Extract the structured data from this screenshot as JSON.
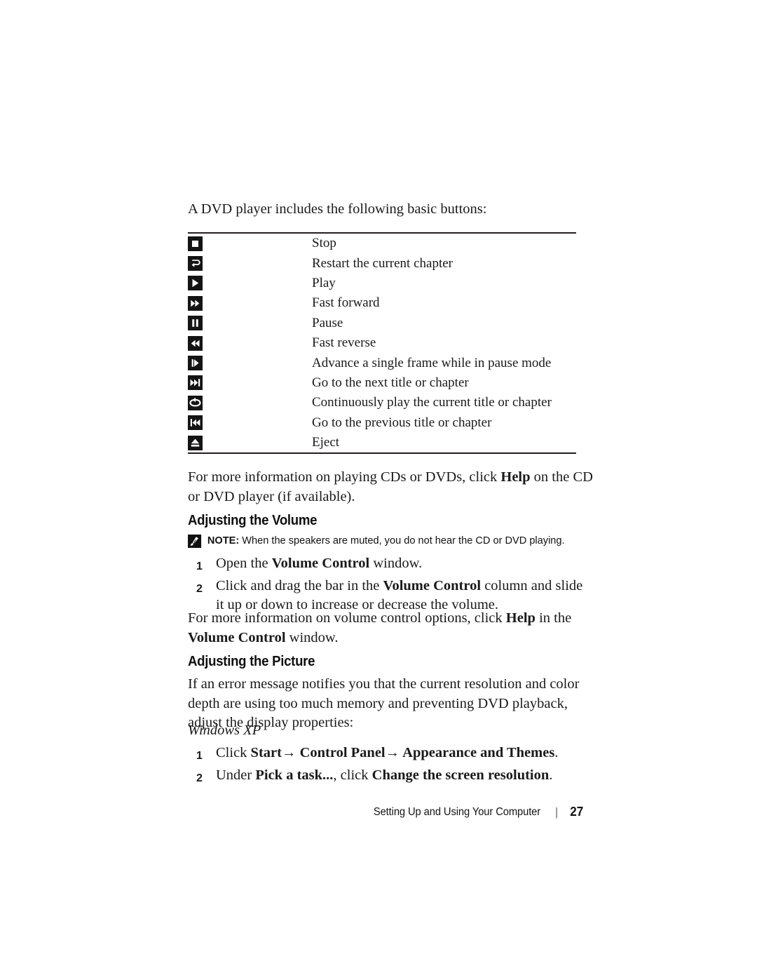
{
  "page": {
    "intro_text": "A DVD player includes the following basic buttons:",
    "windows_label": "Windows XP"
  },
  "button_table": {
    "rows": [
      {
        "icon": "stop-icon",
        "description": "Stop"
      },
      {
        "icon": "restart-chapter-icon",
        "description": "Restart the current chapter"
      },
      {
        "icon": "play-icon",
        "description": "Play"
      },
      {
        "icon": "fast-forward-icon",
        "description": "Fast forward"
      },
      {
        "icon": "pause-icon",
        "description": "Pause"
      },
      {
        "icon": "fast-reverse-icon",
        "description": "Fast reverse"
      },
      {
        "icon": "frame-advance-icon",
        "description": "Advance a single frame while in pause mode"
      },
      {
        "icon": "next-title-icon",
        "description": "Go to the next title or chapter"
      },
      {
        "icon": "loop-play-icon",
        "description": "Continuously play the current title or chapter"
      },
      {
        "icon": "previous-title-icon",
        "description": "Go to the previous title or chapter"
      },
      {
        "icon": "eject-icon",
        "description": "Eject"
      }
    ]
  },
  "sections": {
    "more_info_cd": {
      "part1": "For more information on playing CDs or DVDs, click ",
      "bold1": "Help",
      "part2": " on the CD or DVD player (if available)."
    },
    "volume": {
      "heading": "Adjusting the Volume",
      "note_label": "NOTE:",
      "note_text": " When the speakers are muted, you do not hear the CD or DVD playing.",
      "steps": [
        {
          "number": "1",
          "part1": "Open the ",
          "bold1": "Volume Control",
          "part2": " window."
        },
        {
          "number": "2",
          "part1": "Click and drag the bar in the ",
          "bold1": "Volume Control",
          "part2": " column and slide it up or down to increase or decrease the volume."
        }
      ],
      "more_info": {
        "part1": "For more information on volume control options, click ",
        "bold1": "Help",
        "part2": " in the ",
        "bold2": "Volume Control",
        "part3": " window."
      }
    },
    "picture": {
      "heading": "Adjusting the Picture",
      "body": "If an error message notifies you that the current resolution and color depth are using too much memory and preventing DVD playback, adjust the display properties:",
      "steps": [
        {
          "number": "1",
          "part1": "Click ",
          "bold1": "Start",
          "arrow1": "→",
          "bold2": " Control Panel",
          "arrow2": "→",
          "bold3": " Appearance and Themes",
          "part2": "."
        },
        {
          "number": "2",
          "part1": "Under ",
          "bold1": "Pick a task...",
          "part2": ", click ",
          "bold2": "Change the screen resolution",
          "part3": "."
        }
      ]
    }
  },
  "footer": {
    "title": "Setting Up and Using Your Computer",
    "separator": "|",
    "page_number": "27"
  },
  "colors": {
    "text": "#1a1a1a",
    "icon_background": "#141414",
    "icon_glyph": "#ffffff",
    "rule": "#231f20"
  }
}
